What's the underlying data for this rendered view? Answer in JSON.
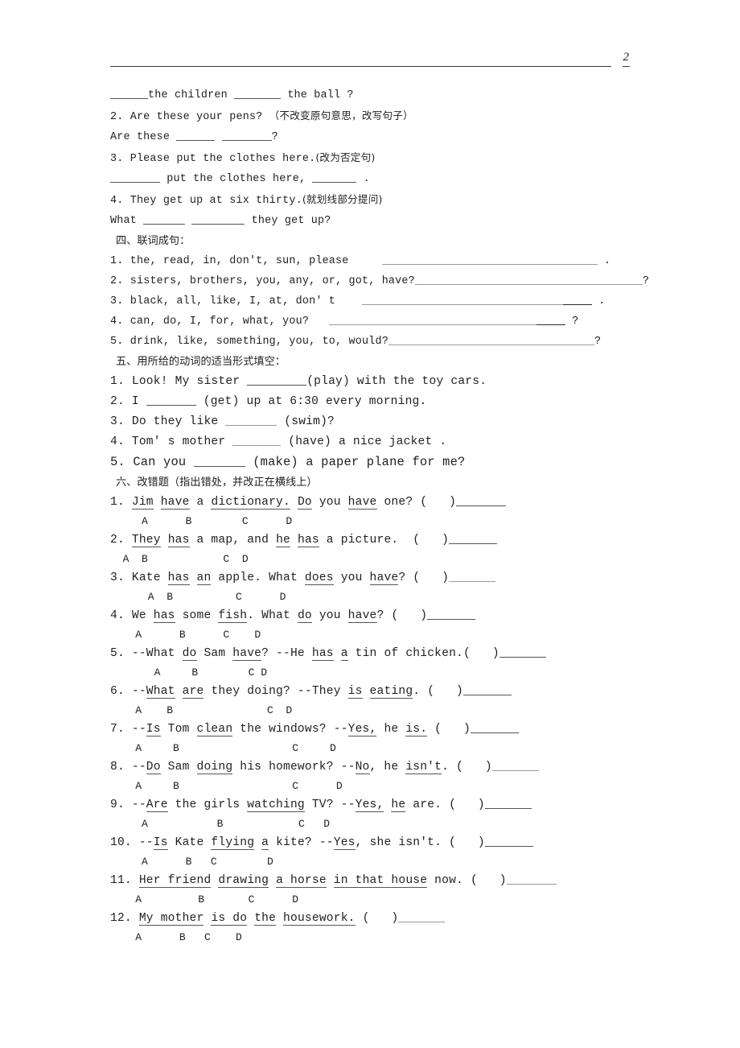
{
  "header": {
    "page_number": "2"
  },
  "sections": {
    "continued_rewrite": {
      "line1": "______the children ________ the ball ?",
      "item2_q": "2. Are these your pens?（不改变原句意思，改写句子）",
      "item2_a": "Are these ______ ________?",
      "item3_q": "3. Please put the clothes here.(改为否定句)",
      "item3_a": "________ put the clothes here, ________ .",
      "item4_q": "4. They get up at six thirty.(就划线部分提问)",
      "item4_a": "What _______ _________ they get up?"
    },
    "section_four": {
      "heading": "四、联词成句：",
      "items": [
        {
          "no": "1.",
          "words": "the, read, in, don't, sun, please",
          "end": "."
        },
        {
          "no": "2.",
          "words": "sisters, brothers, you, any, or, got, have?",
          "end": "?"
        },
        {
          "no": "3.",
          "words": "black, all, like, I, at, don' t",
          "end": "."
        },
        {
          "no": "4.",
          "words": "can, do, I, for, what, you?",
          "end": "?"
        },
        {
          "no": "5.",
          "words": "drink, like, something, you, to, would?",
          "end": "?"
        }
      ]
    },
    "section_five": {
      "heading": "五、用所给的动词的适当形式填空：",
      "items": [
        {
          "no": "1.",
          "before": "Look! My sister ",
          "after": "(play) with the toy cars."
        },
        {
          "no": "2.",
          "before": "I ",
          "after": " (get) up at 6:30 every morning."
        },
        {
          "no": "3.",
          "before": "Do they like ",
          "after": " (swim)?"
        },
        {
          "no": "4.",
          "before": "Tom' s mother ",
          "after": " (have) a nice jacket ."
        },
        {
          "no": "5.",
          "before": "Can you ",
          "after": " (make) a paper plane for me?"
        }
      ]
    },
    "section_six": {
      "heading": "六、改错题（指出错处，并改正在横线上）",
      "items": [
        {
          "no": "1.",
          "text": "Jim have a dictionary. Do you have one? (   )______",
          "letters": "     A      B        C      D"
        },
        {
          "no": "2.",
          "text": "They has a map, and he has a picture.  (   )______",
          "letters": "  A  B            C  D"
        },
        {
          "no": "3.",
          "text": "Kate has an apple. What does you have? (   )______",
          "letters": "      A  B          C      D"
        },
        {
          "no": "4.",
          "text": "We has some fish. What do you have? (   )______",
          "letters": "    A      B      C    D"
        },
        {
          "no": "5.",
          "text": "--What do Sam have? --He has a tin of chicken.(   )______",
          "letters": "       A     B        C D"
        },
        {
          "no": "6.",
          "text": "--What are they doing? --They is eating. (   )______",
          "letters": "    A    B               C  D"
        },
        {
          "no": "7.",
          "text": "--Is Tom clean the windows? --Yes, he is. (   )______",
          "letters": "    A     B                  C     D"
        },
        {
          "no": "8.",
          "text": "--Do Sam doing his homework? --No, he isn't. (   )______",
          "letters": "    A     B                  C      D"
        },
        {
          "no": "9.",
          "text": "--Are the girls watching TV? --Yes, he are. (   )______",
          "letters": "     A           B            C   D"
        },
        {
          "no": "10.",
          "text": "--Is Kate flying a kite? --Yes, she isn't. (   )______",
          "letters": "     A      B   C        D"
        },
        {
          "no": "11.",
          "text": "Her friend drawing a horse in that house now. (   )______",
          "letters": "    A         B       C      D"
        },
        {
          "no": "12.",
          "text": "My mother is do the housework. (   )______",
          "letters": "    A      B   C    D"
        }
      ]
    }
  }
}
